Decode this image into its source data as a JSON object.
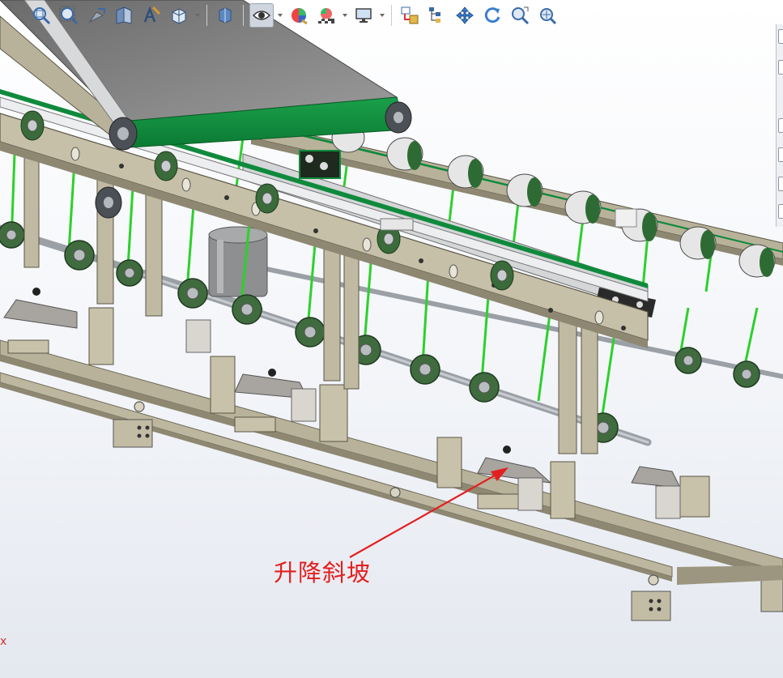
{
  "toolbar": {
    "items": [
      {
        "id": "zoom-to-fit",
        "icon": "zoom-to-fit-icon"
      },
      {
        "id": "zoom-to-area",
        "icon": "zoom-to-area-icon"
      },
      {
        "id": "previous-view",
        "icon": "previous-view-icon"
      },
      {
        "id": "section-view",
        "icon": "section-view-icon"
      },
      {
        "id": "dynamic-annotation",
        "icon": "dynamic-annotation-icon"
      },
      {
        "id": "view-orientation",
        "icon": "view-orientation-icon"
      },
      {
        "id": "display-style",
        "icon": "display-style-icon"
      },
      {
        "id": "hide-show-items",
        "icon": "eye-icon"
      },
      {
        "id": "edit-appearance",
        "icon": "appearance-sphere-icon"
      },
      {
        "id": "apply-scene",
        "icon": "scene-icon"
      },
      {
        "id": "view-settings",
        "icon": "monitor-icon"
      },
      {
        "id": "tool-a",
        "icon": "assembly-layout-icon"
      },
      {
        "id": "tool-b",
        "icon": "component-tree-icon"
      },
      {
        "id": "pan",
        "icon": "pan-icon"
      },
      {
        "id": "rotate",
        "icon": "rotate-icon"
      },
      {
        "id": "zoom-in-out",
        "icon": "zoom-icon"
      },
      {
        "id": "zoom-extents",
        "icon": "zoom-target-icon"
      }
    ]
  },
  "colors": {
    "frame": "#b8b29a",
    "frame_dark": "#8e8873",
    "belt": "#0f8a3c",
    "belt_line": "#2bd12b",
    "pulley": "#3f6b3f",
    "shaft": "#9aa0a6",
    "callout": "#e32020"
  },
  "callout": {
    "label": "升降斜坡"
  },
  "edge_mark": "x"
}
